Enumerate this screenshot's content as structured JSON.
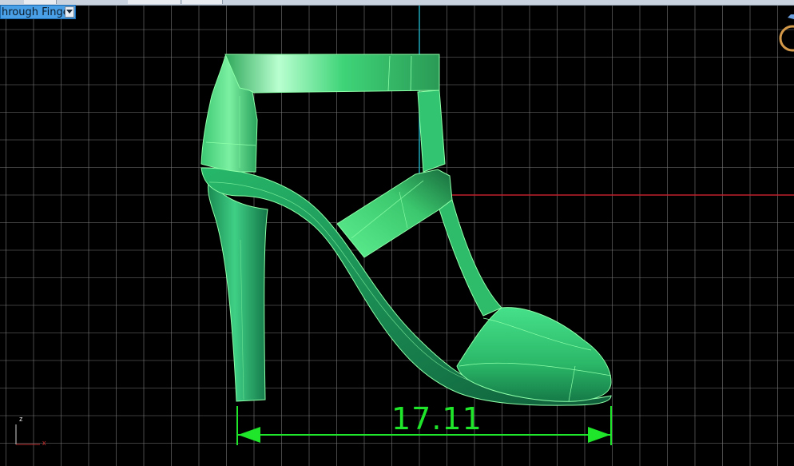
{
  "viewport": {
    "view_name": "hrough Finger",
    "background": "#000000",
    "grid_color": "#7a7a7a",
    "x_axis_color": "#c0202a",
    "y_axis_color": "#1ea6b8"
  },
  "model": {
    "shape_color": "#2fd16b",
    "outline_color": "#8dffa8"
  },
  "dimension": {
    "value": "17.11",
    "color": "#1fe62a"
  },
  "axis_indicator": {
    "z_label": "z",
    "x_label": "x"
  },
  "icons": {
    "view_dropdown": "chevron-down-icon",
    "ring": "ring-icon"
  }
}
